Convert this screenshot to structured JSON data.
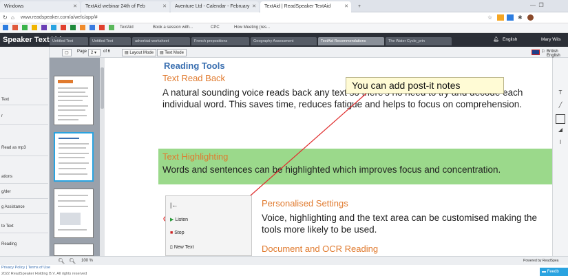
{
  "browser": {
    "tabs": [
      {
        "label": "Windows"
      },
      {
        "label": "TextAid webinar 24th of Feb"
      },
      {
        "label": "Aventure Ltd - Calendar - February"
      },
      {
        "label": "TextAid | ReadSpeaker TextAid"
      },
      {
        "label": "+"
      }
    ],
    "url": "www.readspeaker.com/a/welc/app/#"
  },
  "bookmarks": [
    {
      "label": "TextAid"
    },
    {
      "label": "Book a session with..."
    },
    {
      "label": "CPC"
    },
    {
      "label": "How Meeting (res..."
    }
  ],
  "app": {
    "title": "Speaker TextAid",
    "language": "English",
    "user": "Mary Wils"
  },
  "doc_tabs": [
    {
      "label": "Untitled Text"
    },
    {
      "label": "Untitled Text"
    },
    {
      "label": "adverbial-worksheet"
    },
    {
      "label": "French prepositions"
    },
    {
      "label": "Geography Assessment"
    },
    {
      "label": "TextAid Recommendations"
    },
    {
      "label": "The Water Cycle_prin"
    }
  ],
  "toolbar": {
    "page_label": "Page",
    "page_value": "2",
    "page_of": "of 6",
    "layout_mode": "Layout Mode",
    "text_mode": "Text Mode",
    "voice": "British English"
  },
  "sidebar": {
    "items": [
      {
        "label": "Text"
      },
      {
        "label": "r"
      },
      {
        "label": "Read as mp3"
      },
      {
        "label": "ations"
      },
      {
        "label": "g/der"
      },
      {
        "label": "g Assistance"
      },
      {
        "label": "to Text"
      },
      {
        "label": "Reading"
      }
    ]
  },
  "document": {
    "heading": "Reading Tools",
    "sub1": "Text Read Back",
    "para1": "A natural sounding voice reads back any text so there's no need to try and decode each individual word. This saves time, reduces fatigue and helps to focus on comprehension.",
    "sub2": "Text Highlighting",
    "para2": "Words and sentences can be highlighted which improves focus and concentration.",
    "sub3": "Personalised Settings",
    "para3": "Voice, highlighting and the text area can be customised making the tools more likely to be used.",
    "sub4": "Document and OCR Reading"
  },
  "post_it": "You can add post-it notes",
  "popup": {
    "listen": "Listen",
    "stop": "Stop",
    "new_text": "New Text"
  },
  "status": {
    "zoom": "100 %",
    "powered": "Powered by ReadSpea",
    "feedback": "Feedb"
  },
  "footer": {
    "links": "Privacy Policy | Terms of Use",
    "copyright": "2022 ReadSpeaker Holding B.V. All rights reserved"
  },
  "colors": {
    "highlight": "#9bd98b",
    "heading": "#3a6fb0",
    "subheading": "#e07a2e",
    "annotation": "#e03030",
    "app_header": "#2b2f37"
  }
}
